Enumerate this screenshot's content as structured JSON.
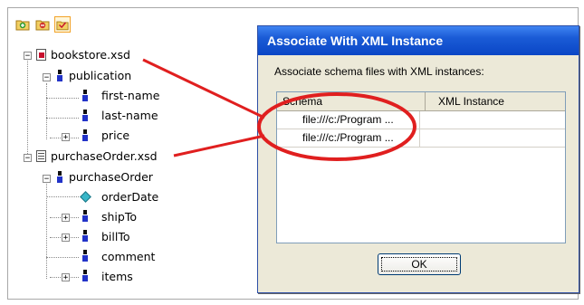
{
  "toolbar": {
    "buttons": [
      {
        "name": "add-schema-button",
        "icon": "folder-add-icon"
      },
      {
        "name": "remove-schema-button",
        "icon": "folder-remove-icon"
      },
      {
        "name": "associate-button",
        "icon": "folder-check-icon"
      }
    ]
  },
  "tree": {
    "nodes": [
      {
        "label": "bookstore.xsd",
        "kind": "schema-file"
      },
      {
        "label": "publication",
        "kind": "element"
      },
      {
        "label": "first-name",
        "kind": "element"
      },
      {
        "label": "last-name",
        "kind": "element"
      },
      {
        "label": "price",
        "kind": "element"
      },
      {
        "label": "purchaseOrder.xsd",
        "kind": "schema-file"
      },
      {
        "label": "purchaseOrder",
        "kind": "element"
      },
      {
        "label": "orderDate",
        "kind": "attribute"
      },
      {
        "label": "shipTo",
        "kind": "element"
      },
      {
        "label": "billTo",
        "kind": "element"
      },
      {
        "label": "comment",
        "kind": "element"
      },
      {
        "label": "items",
        "kind": "element"
      }
    ]
  },
  "dialog": {
    "title": "Associate With XML Instance",
    "instruction": "Associate schema files with XML instances:",
    "columns": [
      "Schema",
      "XML Instance"
    ],
    "rows": [
      {
        "schema": "file:///c:/Program ...",
        "instance": ""
      },
      {
        "schema": "file:///c:/Program ...",
        "instance": ""
      }
    ],
    "ok_label": "OK"
  },
  "colors": {
    "annotation": "#e01f1f",
    "title_bar": "#0a46c6",
    "dialog_bg": "#ece9d8",
    "element_icon": "#2233c8"
  }
}
